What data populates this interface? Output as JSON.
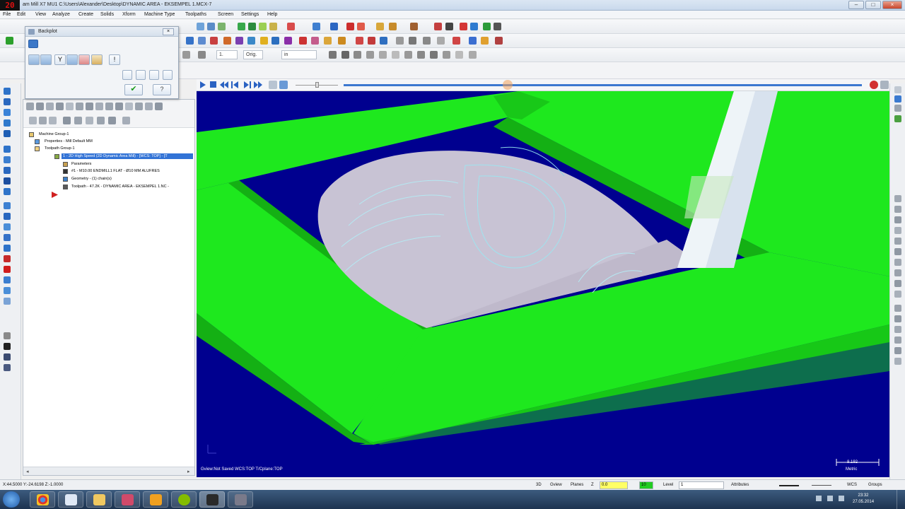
{
  "app": {
    "logo_text": "20",
    "title": "am Mill X7 MU1  C:\\Users\\Alexander\\Desktop\\DYNAMIC AREA - EKSEMPEL 1.MCX-7"
  },
  "menu": [
    "File",
    "Edit",
    "View",
    "Analyze",
    "Create",
    "Solids",
    "Xform",
    "Machine Type",
    "Toolpaths",
    "Screen",
    "Settings",
    "Help"
  ],
  "toolbar": {
    "field_zoom": "1.",
    "field_orig": "Orig.",
    "field_in": "in"
  },
  "backplot": {
    "title": "Backplot"
  },
  "toolpath_manager": {
    "nodes": [
      {
        "label": "Machine Group-1"
      },
      {
        "label": "Properties - Mill Default MM"
      },
      {
        "label": "Toolpath Group-1"
      },
      {
        "label": "1 - 2D High Speed (2D Dynamic Area Mill) - [WCS: TOP] - [T"
      },
      {
        "label": "Parameters"
      },
      {
        "label": "#1 - M10.00 ENDMILL1 FLAT - Ø10 MM ALUFRES"
      },
      {
        "label": "Geometry - (1) chain(s)"
      },
      {
        "label": "Toolpath - 47.2K - DYNAMIC AREA - EKSEMPEL 1.NC -"
      }
    ]
  },
  "viewport": {
    "status": "Gview:Not Saved   WCS:TOP   T/Cplane:TOP",
    "scale_value": "8.192",
    "scale_unit": "Metric",
    "colors": {
      "background": "#00008f",
      "stock": "#1ee81e",
      "part": "#c8c3d4",
      "tool": "#e8eef5"
    }
  },
  "statusbar": {
    "coords": "X:44.5000   Y:-24.6198   Z:-1.0000",
    "mode": "3D",
    "gview": "Gview",
    "planes": "Planes",
    "z_label": "Z",
    "z_value": "0.0",
    "color_value": "10",
    "level_label": "Level",
    "level_value": "1",
    "attributes": "Attributes",
    "wcs": "WCS",
    "groups": "Groups"
  },
  "taskbar": {
    "time": "23:32",
    "date": "27.05.2014"
  }
}
